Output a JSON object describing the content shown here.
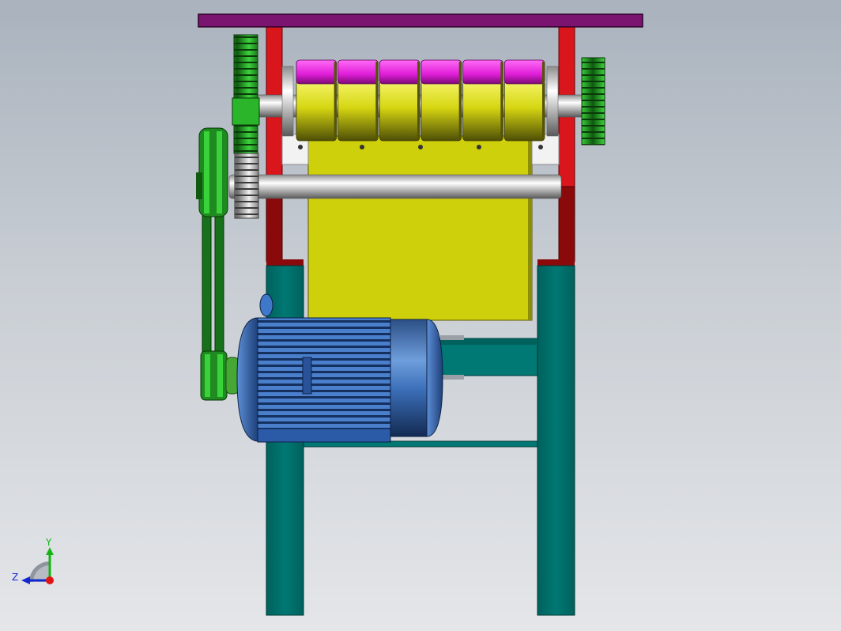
{
  "viewport": {
    "background_top": "#a9b2bd",
    "background_bottom": "#e4e6e9"
  },
  "colors": {
    "top_plate": "#7a1470",
    "frame_red": "#d8161c",
    "frame_dark_red": "#8a0a0c",
    "legs_teal": "#007873",
    "hopper_yellow": "#cfd00c",
    "roller_magenta": "#e01ed8",
    "gear_green": "#2ab52a",
    "pulley_green": "#1f8a1f",
    "motor_blue": "#3f78c8",
    "shaft_silver": "#d8d8d8",
    "bracket_white": "#f2f2f2"
  },
  "components": [
    "top-plate",
    "side-frame-left",
    "side-frame-right",
    "crushing-roller",
    "roller-drive-gear",
    "idler-gear",
    "roller-end-gear",
    "lower-shaft",
    "hopper-body",
    "pulley-upper",
    "v-belt",
    "pulley-motor",
    "electric-motor",
    "motor-mount",
    "frame-leg-left",
    "frame-leg-right",
    "cross-brace"
  ],
  "roller_segments": 6,
  "triad": {
    "y_label": "Y",
    "z_label": "Z",
    "y_color": "#14b414",
    "z_color": "#1428d0",
    "origin_color": "#e01414"
  }
}
